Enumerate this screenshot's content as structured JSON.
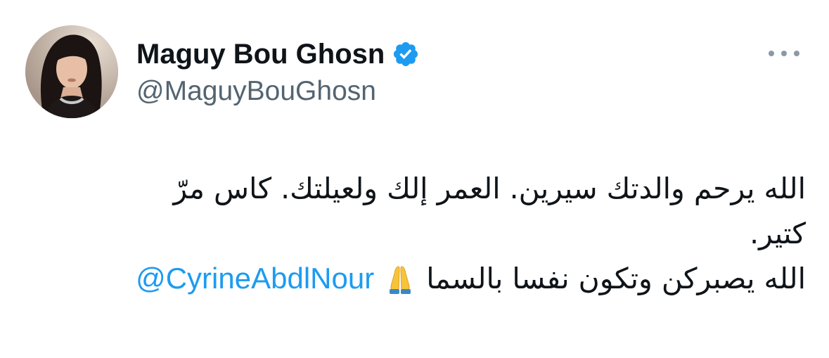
{
  "tweet": {
    "author": {
      "display_name": "Maguy Bou Ghosn",
      "handle": "@MaguyBouGhosn",
      "verified": true,
      "verified_icon": "verified-badge-icon",
      "avatar": "profile-photo"
    },
    "more_icon": "more-options-icon",
    "body": {
      "line1": "الله يرحم والدتك سيرين. العمر إلك ولعيلتك. كاس مرّ",
      "line2": "كتير.",
      "line3_text": "الله يصبركن وتكون نفسا بالسما",
      "emoji": "folded-hands-emoji",
      "mention": "@CyrineAbdlNour"
    },
    "colors": {
      "link": "#1d9bf0",
      "handle": "#536471",
      "verified": "#1d9bf0",
      "text": "#0f1419"
    }
  }
}
